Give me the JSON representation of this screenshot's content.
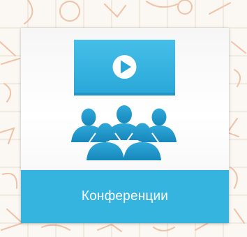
{
  "tile": {
    "label": "Конференции",
    "icon": "video-conference-icon",
    "accent_color": "#35b4e0",
    "icon_color": "#1b93c4"
  }
}
